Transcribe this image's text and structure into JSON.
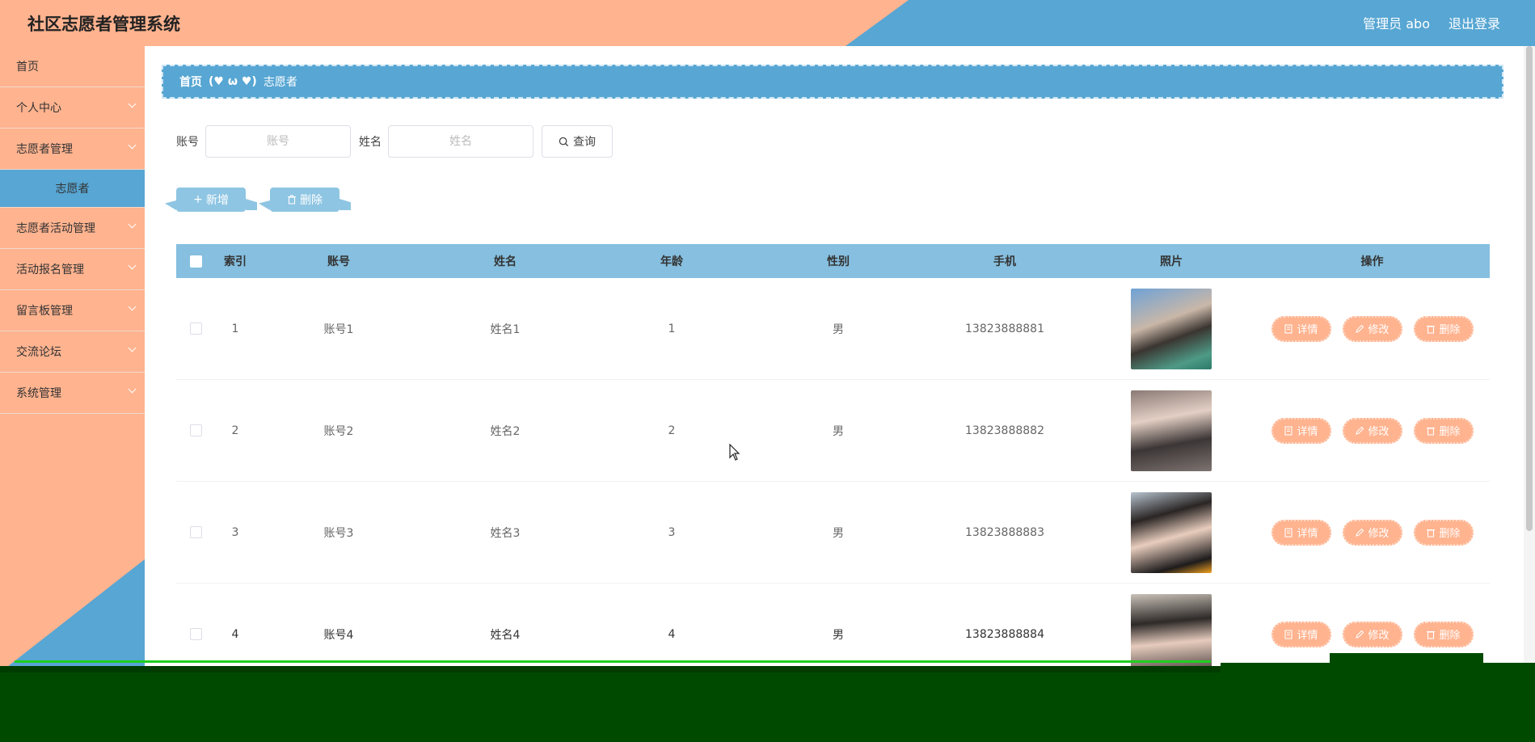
{
  "header": {
    "title": "社区志愿者管理系统",
    "user": "管理员 abo",
    "logout": "退出登录"
  },
  "sidebar": {
    "items": [
      {
        "label": "首页",
        "has_arrow": false
      },
      {
        "label": "个人中心",
        "has_arrow": true
      },
      {
        "label": "志愿者管理",
        "has_arrow": true
      },
      {
        "label": "志愿者",
        "sub": true
      },
      {
        "label": "志愿者活动管理",
        "has_arrow": true
      },
      {
        "label": "活动报名管理",
        "has_arrow": true
      },
      {
        "label": "留言板管理",
        "has_arrow": true
      },
      {
        "label": "交流论坛",
        "has_arrow": true
      },
      {
        "label": "系统管理",
        "has_arrow": true
      }
    ]
  },
  "breadcrumb": {
    "home": "首页",
    "separator": "(♥ ω ♥)",
    "current": "志愿者"
  },
  "search": {
    "account_label": "账号",
    "account_placeholder": "账号",
    "name_label": "姓名",
    "name_placeholder": "姓名",
    "query_button": "查询"
  },
  "actions": {
    "add": "新增",
    "delete": "删除"
  },
  "table": {
    "columns": [
      "索引",
      "账号",
      "姓名",
      "年龄",
      "性别",
      "手机",
      "照片",
      "操作"
    ],
    "rows": [
      {
        "index": "1",
        "account": "账号1",
        "name": "姓名1",
        "age": "1",
        "gender": "男",
        "phone": "13823888881"
      },
      {
        "index": "2",
        "account": "账号2",
        "name": "姓名2",
        "age": "2",
        "gender": "男",
        "phone": "13823888882"
      },
      {
        "index": "3",
        "account": "账号3",
        "name": "姓名3",
        "age": "3",
        "gender": "男",
        "phone": "13823888883"
      },
      {
        "index": "4",
        "account": "账号4",
        "name": "姓名4",
        "age": "4",
        "gender": "男",
        "phone": "13823888884"
      }
    ],
    "row_ops": {
      "detail": "详情",
      "edit": "修改",
      "delete": "删除"
    }
  },
  "colors": {
    "salmon": "#ffb38f",
    "blue": "#57a6d3",
    "table_header": "#86bfdf"
  }
}
